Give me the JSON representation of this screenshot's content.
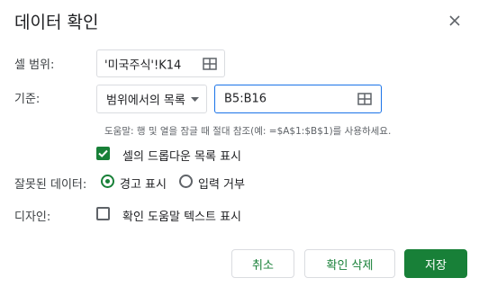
{
  "dialog": {
    "title": "데이터 확인",
    "close_icon": "close-icon"
  },
  "range": {
    "label": "셀 범위:",
    "value": "'미국주식'!K14",
    "icon": "grid-icon"
  },
  "criteria": {
    "label": "기준:",
    "type": "범위에서의 목록",
    "range_value": "B5:B16",
    "help_text": "도움말: 행 및 열을 잠글 때 절대 참조(예: =$A$1:$B$1)를 사용하세요.",
    "show_dropdown_label": "셀의 드롭다운 목록 표시",
    "show_dropdown_checked": true
  },
  "invalid_data": {
    "label": "잘못된 데이터:",
    "options": [
      "경고 표시",
      "입력 거부"
    ],
    "selected": "경고 표시"
  },
  "appearance": {
    "label": "디자인:",
    "help_text_label": "확인 도움말 텍스트 표시",
    "checked": false
  },
  "buttons": {
    "cancel": "취소",
    "remove": "확인 삭제",
    "save": "저장"
  },
  "colors": {
    "accent": "#188038",
    "focus": "#1a73e8"
  }
}
